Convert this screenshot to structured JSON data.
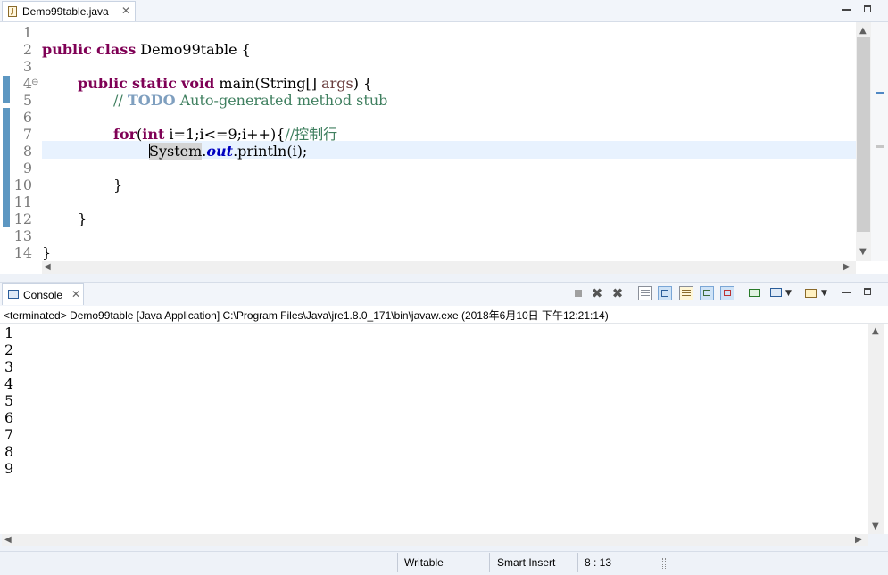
{
  "editor": {
    "tab_label": "Demo99table.java",
    "tab_close": "✕",
    "file_icon": "J",
    "line_numbers": [
      "1",
      "2",
      "3",
      "4",
      "5",
      "6",
      "7",
      "8",
      "9",
      "10",
      "11",
      "12",
      "13",
      "14"
    ],
    "fold_marker": "⊖",
    "code": {
      "l2_kw1": "public",
      "l2_kw2": "class",
      "l2_name": " Demo99table {",
      "l4_kw1": "public",
      "l4_kw2": "static",
      "l4_kw3": "void",
      "l4_rest": " main(String[] ",
      "l4_param": "args",
      "l4_end": ") {",
      "l5_c1": "// ",
      "l5_todo": "TODO",
      "l5_c2": " Auto-generated method stub",
      "l7_kw": "for",
      "l7_p1": "(",
      "l7_kw2": "int",
      "l7_rest": " i=1;i<=9;i++){",
      "l7_comment": "//控制行",
      "l8_sys": "System",
      "l8_dot": ".",
      "l8_out": "out",
      "l8_rest": ".println(i);",
      "l10": "}",
      "l12": "}",
      "l14": "}"
    }
  },
  "console": {
    "tab_label": "Console",
    "tab_close": "✕",
    "header": "<terminated> Demo99table [Java Application] C:\\Program Files\\Java\\jre1.8.0_171\\bin\\javaw.exe (2018年6月10日 下午12:21:14)",
    "output": [
      "1",
      "2",
      "3",
      "4",
      "5",
      "6",
      "7",
      "8",
      "9"
    ]
  },
  "status_bar": {
    "writable": "Writable",
    "insert_mode": "Smart Insert",
    "position": "8 : 13"
  },
  "scroll_arrows": {
    "up": "▲",
    "down": "▼",
    "left": "◀",
    "right": "▶"
  },
  "colors": {
    "keyword": "#7f0055",
    "comment": "#3f7f5f",
    "todo": "#7f9fbf",
    "static_field": "#0000c0",
    "current_line": "#e8f2fe"
  }
}
